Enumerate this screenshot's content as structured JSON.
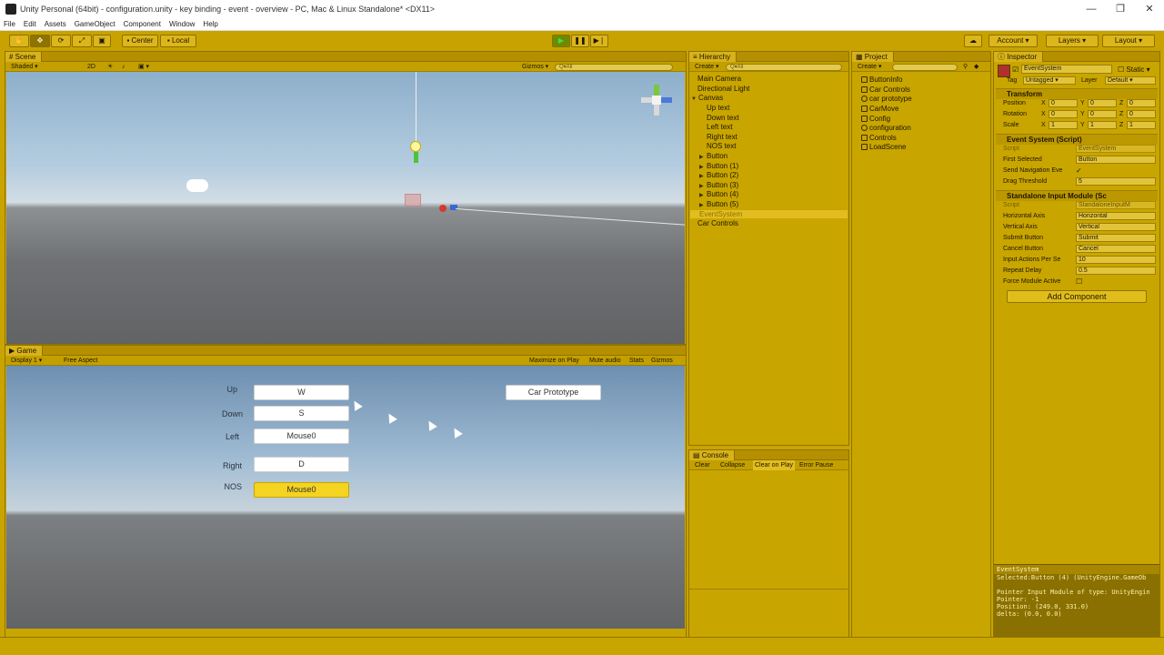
{
  "window": {
    "title": "Unity Personal (64bit) - configuration.unity - key binding - event - overview - PC, Mac & Linux Standalone* <DX11>",
    "controls": [
      "—",
      "❐",
      "✕"
    ]
  },
  "menu": [
    "File",
    "Edit",
    "Assets",
    "GameObject",
    "Component",
    "Window",
    "Help"
  ],
  "toolbar": {
    "pivot": "Center",
    "space": "Local",
    "account": "Account",
    "layers": "Layers",
    "layout": "Layout"
  },
  "scene": {
    "tab": "Scene",
    "shading": "Shaded",
    "mode2d": "2D",
    "gizmos": "Gizmos",
    "search": "Q▾All"
  },
  "game": {
    "tab": "Game",
    "display": "Display 1",
    "aspect": "Free Aspect",
    "options": [
      "Maximize on Play",
      "Mute audio",
      "Stats",
      "Gizmos"
    ],
    "rows": [
      {
        "label": "Up",
        "key": "W"
      },
      {
        "label": "Down",
        "key": "S"
      },
      {
        "label": "Left",
        "key": "Mouse0"
      },
      {
        "label": "Right",
        "key": "D"
      },
      {
        "label": "NOS",
        "key": "Mouse0"
      }
    ],
    "car_button": "Car Prototype"
  },
  "hierarchy": {
    "tab": "Hierarchy",
    "create": "Create",
    "search": "Q▾All",
    "items": [
      "Main Camera",
      "Directional Light",
      "Canvas",
      "Up text",
      "Down text",
      "Left text",
      "Right text",
      "NOS text",
      "Button",
      "Button (1)",
      "Button (2)",
      "Button (3)",
      "Button (4)",
      "Button (5)",
      "EventSystem",
      "Car Controls"
    ]
  },
  "project": {
    "tab": "Project",
    "create": "Create",
    "items": [
      "ButtonInfo",
      "Car Controls",
      "car prototype",
      "CarMove",
      "Config",
      "configuration",
      "Controls",
      "LoadScene"
    ]
  },
  "console": {
    "tab": "Console",
    "buttons": [
      "Clear",
      "Collapse",
      "Clear on Play",
      "Error Pause"
    ]
  },
  "inspector": {
    "tab": "Inspector",
    "object_name": "EventSystem",
    "static_label": "Static",
    "tag_label": "Tag",
    "tag_value": "Untagged",
    "layer_label": "Layer",
    "layer_value": "Default",
    "transform": {
      "header": "Transform",
      "rows": [
        {
          "label": "Position",
          "x": "0",
          "y": "0",
          "z": "0"
        },
        {
          "label": "Rotation",
          "x": "0",
          "y": "0",
          "z": "0"
        },
        {
          "label": "Scale",
          "x": "1",
          "y": "1",
          "z": "1"
        }
      ]
    },
    "event_system": {
      "header": "Event System (Script)",
      "script_label": "Script",
      "script_value": "EventSystem",
      "first_selected_label": "First Selected",
      "first_selected_value": "Button",
      "send_nav_label": "Send Navigation Eve",
      "send_nav_value": "✓",
      "drag_label": "Drag Threshold",
      "drag_value": "5"
    },
    "input_module": {
      "header": "Standalone Input Module (Sc",
      "script_label": "Script",
      "script_value": "StandaloneInputM",
      "h_axis_label": "Horizontal Axis",
      "h_axis_value": "Horizontal",
      "v_axis_label": "Vertical Axis",
      "v_axis_value": "Vertical",
      "submit_label": "Submit Button",
      "submit_value": "Submit",
      "cancel_label": "Cancel Button",
      "cancel_value": "Cancel",
      "actions_label": "Input Actions Per Se",
      "actions_value": "10",
      "repeat_label": "Repeat Delay",
      "repeat_value": "0.5",
      "force_label": "Force Module Active"
    },
    "add_component": "Add Component",
    "preview": {
      "title": "EventSystem",
      "lines": [
        "Selected:Button (4) (UnityEngine.GameOb",
        "",
        "Pointer Input Module of type: UnityEngin",
        "Pointer: -1",
        "Position: (249.0, 331.0)",
        "delta: (0.0, 0.0)"
      ]
    }
  }
}
